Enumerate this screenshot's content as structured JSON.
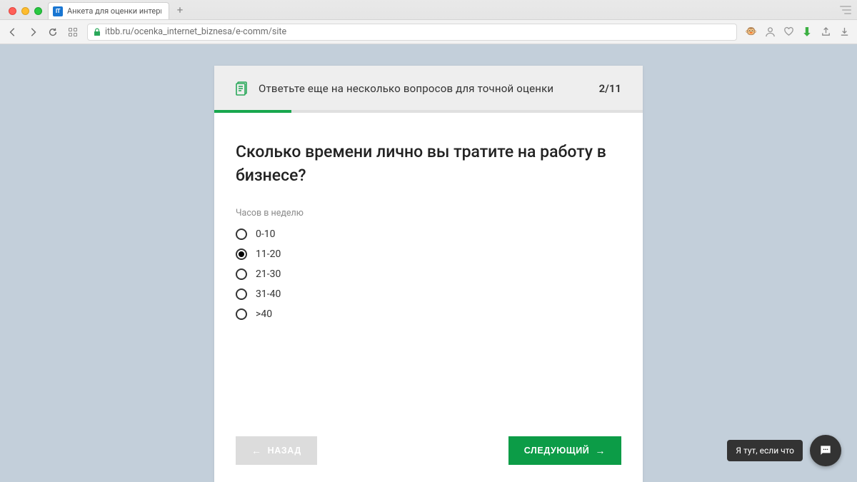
{
  "browser": {
    "tab_title": "Анкета для оценки интерне",
    "favicon_text": "IT",
    "url": "itbb.ru/ocenka_internet_biznesa/e-comm/site"
  },
  "header": {
    "title": "Ответьте еще на несколько вопросов для точной оценки",
    "counter": "2/11"
  },
  "question": {
    "text": "Сколько времени лично вы тратите на работу в бизнесе?",
    "sublabel": "Часов в неделю"
  },
  "options": [
    {
      "label": "0-10",
      "selected": false
    },
    {
      "label": "11-20",
      "selected": true
    },
    {
      "label": "21-30",
      "selected": false
    },
    {
      "label": "31-40",
      "selected": false
    },
    {
      "label": ">40",
      "selected": false
    }
  ],
  "buttons": {
    "back": "НАЗАД",
    "next": "СЛЕДУЮЩИЙ"
  },
  "chat": {
    "tooltip": "Я тут, если что"
  }
}
